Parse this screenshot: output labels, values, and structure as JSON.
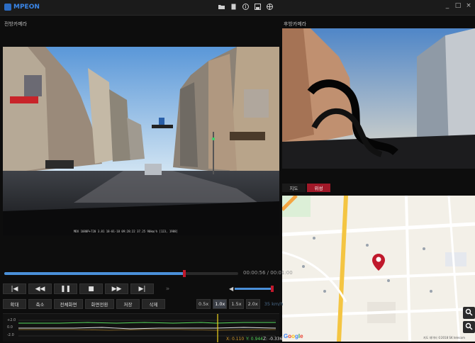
{
  "app": {
    "title": "MPEON",
    "toolbar_icons": [
      "folder-icon",
      "document-icon",
      "info-icon",
      "save-icon",
      "globe-icon"
    ],
    "window_controls": [
      "_",
      "□",
      "×"
    ]
  },
  "front_camera": {
    "label": "전방카메라",
    "overlay_text": "MDX 1080P+720 3.81  18-01-18 09:28:22  37.25  90km/h  [123, 1988]"
  },
  "rear_camera": {
    "label": "후방카메라"
  },
  "playback": {
    "progress": 0.77,
    "time_text": "00:00:56 / 00:01:00",
    "volume": 0.97
  },
  "controls": {
    "buttons": [
      "|◀",
      "◀◀",
      "❚❚",
      "■",
      "▶▶",
      "▶|",
      "»"
    ]
  },
  "functions": {
    "buttons": [
      "확대",
      "축소",
      "전체화면",
      "화면전환",
      "저장",
      "삭제"
    ]
  },
  "speed": {
    "options": [
      "0.5x",
      "1.0x",
      "1.5x",
      "2.0x"
    ],
    "selected": "1.0x",
    "readout": "35 km/h"
  },
  "graph": {
    "axis_labels": [
      "+2.0",
      "0.0",
      "-2.0"
    ],
    "x_readout": "X: 0.110",
    "y_readout": "Y: 0.944",
    "z_readout": "Z: -0.336",
    "colors": {
      "x": "#d9a030",
      "y": "#57d95d",
      "z": "#e0e0e0"
    }
  },
  "map_panel": {
    "tabs": [
      "지도",
      "위성"
    ],
    "selected_tab": "위성",
    "copyright": "지도 데이터 ©2018 SK telecom",
    "google": "Google",
    "zoom_in_icon": "zoom-in-icon",
    "zoom_out_icon": "zoom-out-icon"
  }
}
